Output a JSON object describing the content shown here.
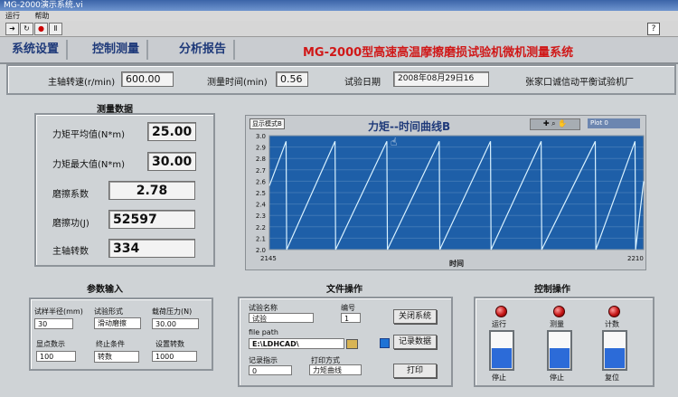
{
  "window": {
    "title": "MG-2000演示系统.vi",
    "menu": [
      "运行",
      "帮助"
    ],
    "help_glyph": "?"
  },
  "header": {
    "tabs": [
      "系统设置",
      "控制测量",
      "分析报告"
    ],
    "app_title": "MG-2000型高速高温摩擦磨损试验机微机测量系统"
  },
  "info_bar": {
    "spindle_speed_label": "主轴转速(r/min)",
    "spindle_speed_value": "600.00",
    "measure_time_label": "测量时间(min)",
    "measure_time_value": "0.56",
    "test_date_label": "试验日期",
    "test_date_value": "2008年08月29日16",
    "company": "张家口诚信动平衡试验机厂"
  },
  "measurements": {
    "title": "测量数据",
    "items": [
      {
        "label": "力矩平均值(N*m)",
        "value": "25.00"
      },
      {
        "label": "力矩最大值(N*m)",
        "value": "30.00"
      },
      {
        "label": "磨擦系数",
        "value": "2.78"
      },
      {
        "label": "磨擦功(J)",
        "value": "52597"
      },
      {
        "label": "主轴转数",
        "value": "334"
      }
    ]
  },
  "chart": {
    "mode_button": "显示模式B",
    "title": "力矩--时间曲线B",
    "plot_legend": "Plot 0",
    "background": "#1e5fa8",
    "line_color": "#d8f1ff"
  },
  "chart_data": {
    "type": "line",
    "title": "力矩--时间曲线B",
    "xlabel": "时间",
    "ylabel": "",
    "xlim": [
      2145,
      2210
    ],
    "ylim": [
      2.0,
      3.0
    ],
    "x": [
      2145,
      2147.9,
      2148,
      2156.4,
      2156.5,
      2165.4,
      2165.5,
      2174.5,
      2174.6,
      2183.4,
      2183.5,
      2192.2,
      2192.3,
      2201.6,
      2201.7,
      2208.5,
      2208.6,
      2210
    ],
    "y": [
      2.56,
      2.95,
      2.0,
      2.95,
      2.0,
      2.95,
      2.0,
      2.95,
      2.0,
      2.95,
      2.0,
      2.95,
      2.0,
      2.95,
      2.0,
      2.95,
      2.0,
      2.6
    ],
    "y_ticks": [
      "3.0",
      "2.9",
      "2.8",
      "2.7",
      "2.6",
      "2.5",
      "2.4",
      "2.3",
      "2.2",
      "2.1",
      "2.0"
    ],
    "x_ticks": [
      "2145",
      "2210"
    ],
    "grid": true,
    "legend_position": "top-right"
  },
  "params": {
    "title": "参数输入",
    "sample_radius_label": "试样半径(mm)",
    "sample_radius_value": "30",
    "test_form_label": "试验形式",
    "test_form_value": "滑动磨擦",
    "load_label": "载荷压力(N)",
    "load_value": "30.00",
    "display_points_label": "显点数示",
    "display_points_value": "100",
    "end_condition_label": "终止条件",
    "end_condition_value": "转数",
    "set_speed_label": "设置转数",
    "set_speed_value": "1000"
  },
  "file_ops": {
    "title": "文件操作",
    "test_name_label": "试验名称",
    "test_name_value": "试验",
    "number_label": "编号",
    "number_value": "1",
    "file_path_label": "file path",
    "file_path_value": "E:\\LDHCAD\\",
    "record_label": "记录指示",
    "record_value": "0",
    "print_mode_label": "打印方式",
    "print_mode_value": "力矩曲线",
    "close_button": "关闭系统",
    "record_button": "记录数据",
    "print_button": "打印"
  },
  "control_ops": {
    "title": "控制操作",
    "leds": [
      "运行",
      "测量",
      "计数"
    ],
    "buttons": [
      "停止",
      "停止",
      "复位"
    ]
  }
}
